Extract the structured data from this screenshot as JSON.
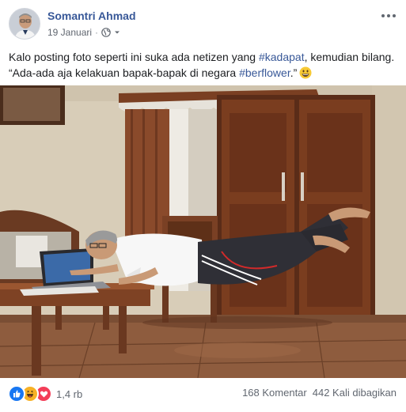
{
  "post": {
    "author": "Somantri Ahmad",
    "date": "19 Januari",
    "separator": "·",
    "privacy_icon": "globe-icon",
    "more_icon": "more-options-icon",
    "text_before_tag1": "Kalo posting foto seperti ini suka ada netizen yang ",
    "hashtag1": "#kadapat",
    "text_after_tag1": ", kemudian bilang.",
    "text_line2_before_tag2": "“Ada-ada aja kelakuan bapak-bapak di negara ",
    "hashtag2": "#berflower",
    "text_after_tag2": ".”",
    "emoji_icon": "grinning-face-emoji"
  },
  "footer": {
    "reaction_icons": [
      "like-reaction-icon",
      "haha-reaction-icon",
      "love-reaction-icon"
    ],
    "reaction_count": "1,4 rb",
    "comments": "168 Komentar",
    "shares": "442 Kali dibagikan"
  },
  "colors": {
    "link_blue": "#385898",
    "text": "#1c1e21",
    "muted": "#616770",
    "like": "#1877f2",
    "haha": "#f7b125",
    "love": "#f33e58"
  }
}
